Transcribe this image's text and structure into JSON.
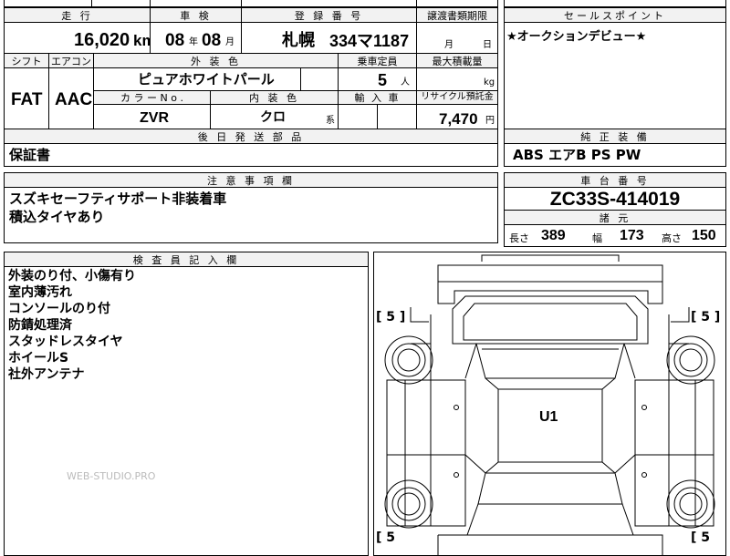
{
  "header": {
    "mileage_label": "走 行",
    "inspection_label": "車 検",
    "registration_label": "登 録 番 号",
    "transfer_label": "譲渡書類期限",
    "sales_points_label": "セールスポイント"
  },
  "values": {
    "mileage": "16,020",
    "mileage_unit": "km",
    "inspection_year": "08",
    "inspection_year_unit": "年",
    "inspection_month": "08",
    "inspection_month_unit": "月",
    "plate_region": "札幌",
    "plate_number": "334マ1187",
    "transfer_month_unit": "月",
    "transfer_day_unit": "日",
    "sales_point": "★オークションデビュー★"
  },
  "spec": {
    "shift_label": "シフト",
    "aircon_label": "エアコン",
    "exterior_color_label": "外 装 色",
    "capacity_label": "乗車定員",
    "max_load_label": "最大積載量",
    "shift": "FAT",
    "aircon": "AAC",
    "exterior_color": "ピュアホワイトパール",
    "capacity": "5",
    "capacity_unit": "人",
    "load_unit": "kg",
    "color_no_label": "カ ラ ー N o .",
    "interior_color_label": "内 装 色",
    "import_label": "輸 入 車",
    "recycle_label": "リサイクル預託金",
    "color_no": "ZVR",
    "interior_color": "クロ",
    "interior_color_unit": "系",
    "recycle_fee": "7,470",
    "recycle_unit": "円"
  },
  "later_parts": {
    "label": "後 日 発 送 部 品",
    "value": "保証書"
  },
  "genuine_equipment": {
    "label": "純 正 装 備",
    "value": "ABS エアB PS PW"
  },
  "notes": {
    "label": "注 意 事 項 欄",
    "lines": [
      "スズキセーフティサポート非装着車",
      "積込タイヤあり"
    ]
  },
  "chassis": {
    "label": "車 台 番 号",
    "value": "ZC33S-414019"
  },
  "dimensions": {
    "label": "諸 元",
    "length_label": "長さ",
    "length": "389",
    "width_label": "幅",
    "width": "173",
    "height_label": "高さ",
    "height": "150"
  },
  "inspector": {
    "label": "検 査 員 記 入 欄",
    "lines": [
      "外装のり付、小傷有り",
      "室内薄汚れ",
      "コンソールのり付",
      "防錆処理済",
      "スタッドレスタイヤ",
      "ホイールS",
      "社外アンテナ"
    ]
  },
  "diagram": {
    "tire_fl": "[ 5 ]",
    "tire_fr": "[ 5 ]",
    "tire_rl": "[ 5",
    "tire_rr": "[ 5",
    "interior_grade": "U1"
  },
  "watermark": "WEB-STUDIO.PRO"
}
